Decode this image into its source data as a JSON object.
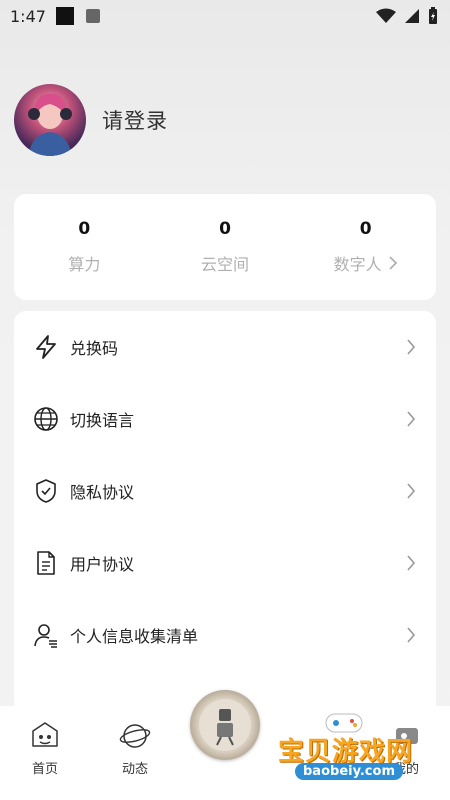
{
  "status_bar": {
    "time": "1:47"
  },
  "profile": {
    "login_text": "请登录"
  },
  "stats": [
    {
      "value": "0",
      "label": "算力"
    },
    {
      "value": "0",
      "label": "云空间"
    },
    {
      "value": "0",
      "label": "数字人"
    }
  ],
  "menu": [
    {
      "label": "兑换码",
      "icon": "lightning-icon"
    },
    {
      "label": "切换语言",
      "icon": "globe-icon"
    },
    {
      "label": "隐私协议",
      "icon": "shield-check-icon"
    },
    {
      "label": "用户协议",
      "icon": "document-icon"
    },
    {
      "label": "个人信息收集清单",
      "icon": "user-list-icon"
    }
  ],
  "tabs": [
    {
      "label": "首页",
      "icon": "home-robot-icon"
    },
    {
      "label": "动态",
      "icon": "planet-icon"
    },
    {
      "label": "我的",
      "icon": "profile-icon"
    }
  ],
  "watermark": {
    "title": "宝贝游戏网",
    "url": "baobeiy.com"
  }
}
